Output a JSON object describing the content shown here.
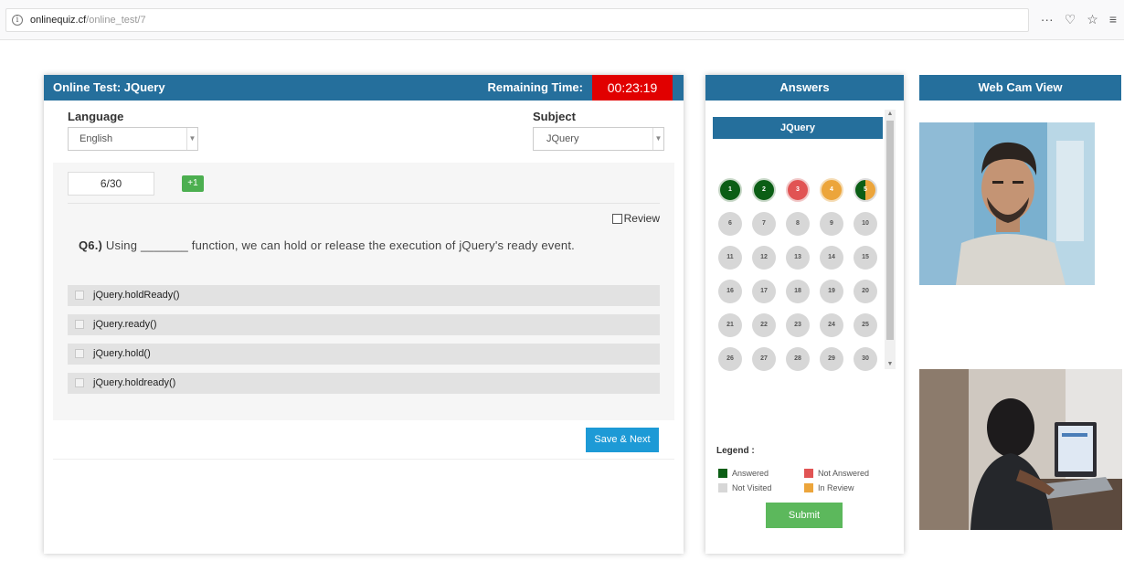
{
  "browser": {
    "url_host": "onlinequiz.cf",
    "url_path": "/online_test/7",
    "actions": [
      "···",
      "♡",
      "☆",
      "≡"
    ]
  },
  "test": {
    "title": "Online Test: JQuery",
    "remaining_label": "Remaining Time:",
    "timer": "00:23:19",
    "language_label": "Language",
    "language_value": "English",
    "subject_label": "Subject",
    "subject_value": "JQuery",
    "counter": "6/30",
    "plus_badge": "+1",
    "review_label": "Review",
    "question_number": "Q6.)",
    "question_text": "Using _______ function, we can hold or release the execution of jQuery's ready event.",
    "options": [
      "jQuery.holdReady()",
      "jQuery.ready()",
      "jQuery.hold()",
      "jQuery.holdready()"
    ],
    "save_next_label": "Save & Next"
  },
  "answers": {
    "title": "Answers",
    "subject_tab": "JQuery",
    "questions": [
      {
        "n": "1",
        "status": "answered"
      },
      {
        "n": "2",
        "status": "answered"
      },
      {
        "n": "3",
        "status": "not-answered"
      },
      {
        "n": "4",
        "status": "in-review"
      },
      {
        "n": "5",
        "status": "answered-review"
      },
      {
        "n": "6",
        "status": "not-visited"
      },
      {
        "n": "7",
        "status": "not-visited"
      },
      {
        "n": "8",
        "status": "not-visited"
      },
      {
        "n": "9",
        "status": "not-visited"
      },
      {
        "n": "10",
        "status": "not-visited"
      },
      {
        "n": "11",
        "status": "not-visited"
      },
      {
        "n": "12",
        "status": "not-visited"
      },
      {
        "n": "13",
        "status": "not-visited"
      },
      {
        "n": "14",
        "status": "not-visited"
      },
      {
        "n": "15",
        "status": "not-visited"
      },
      {
        "n": "16",
        "status": "not-visited"
      },
      {
        "n": "17",
        "status": "not-visited"
      },
      {
        "n": "18",
        "status": "not-visited"
      },
      {
        "n": "19",
        "status": "not-visited"
      },
      {
        "n": "20",
        "status": "not-visited"
      },
      {
        "n": "21",
        "status": "not-visited"
      },
      {
        "n": "22",
        "status": "not-visited"
      },
      {
        "n": "23",
        "status": "not-visited"
      },
      {
        "n": "24",
        "status": "not-visited"
      },
      {
        "n": "25",
        "status": "not-visited"
      },
      {
        "n": "26",
        "status": "not-visited"
      },
      {
        "n": "27",
        "status": "not-visited"
      },
      {
        "n": "28",
        "status": "not-visited"
      },
      {
        "n": "29",
        "status": "not-visited"
      },
      {
        "n": "30",
        "status": "not-visited"
      }
    ],
    "legend_title": "Legend :",
    "legend": {
      "answered": "Answered",
      "not_answered": "Not Answered",
      "not_visited": "Not Visited",
      "in_review": "In Review"
    },
    "submit_label": "Submit"
  },
  "webcam": {
    "title": "Web Cam View"
  },
  "colors": {
    "header_blue": "#256f9c",
    "timer_red": "#e10000",
    "answered": "#0b5e15",
    "not_answered": "#e15454",
    "not_visited": "#d7d7d7",
    "in_review": "#eca53b",
    "save_button": "#1d9ad6",
    "submit_button": "#5cb85c"
  }
}
